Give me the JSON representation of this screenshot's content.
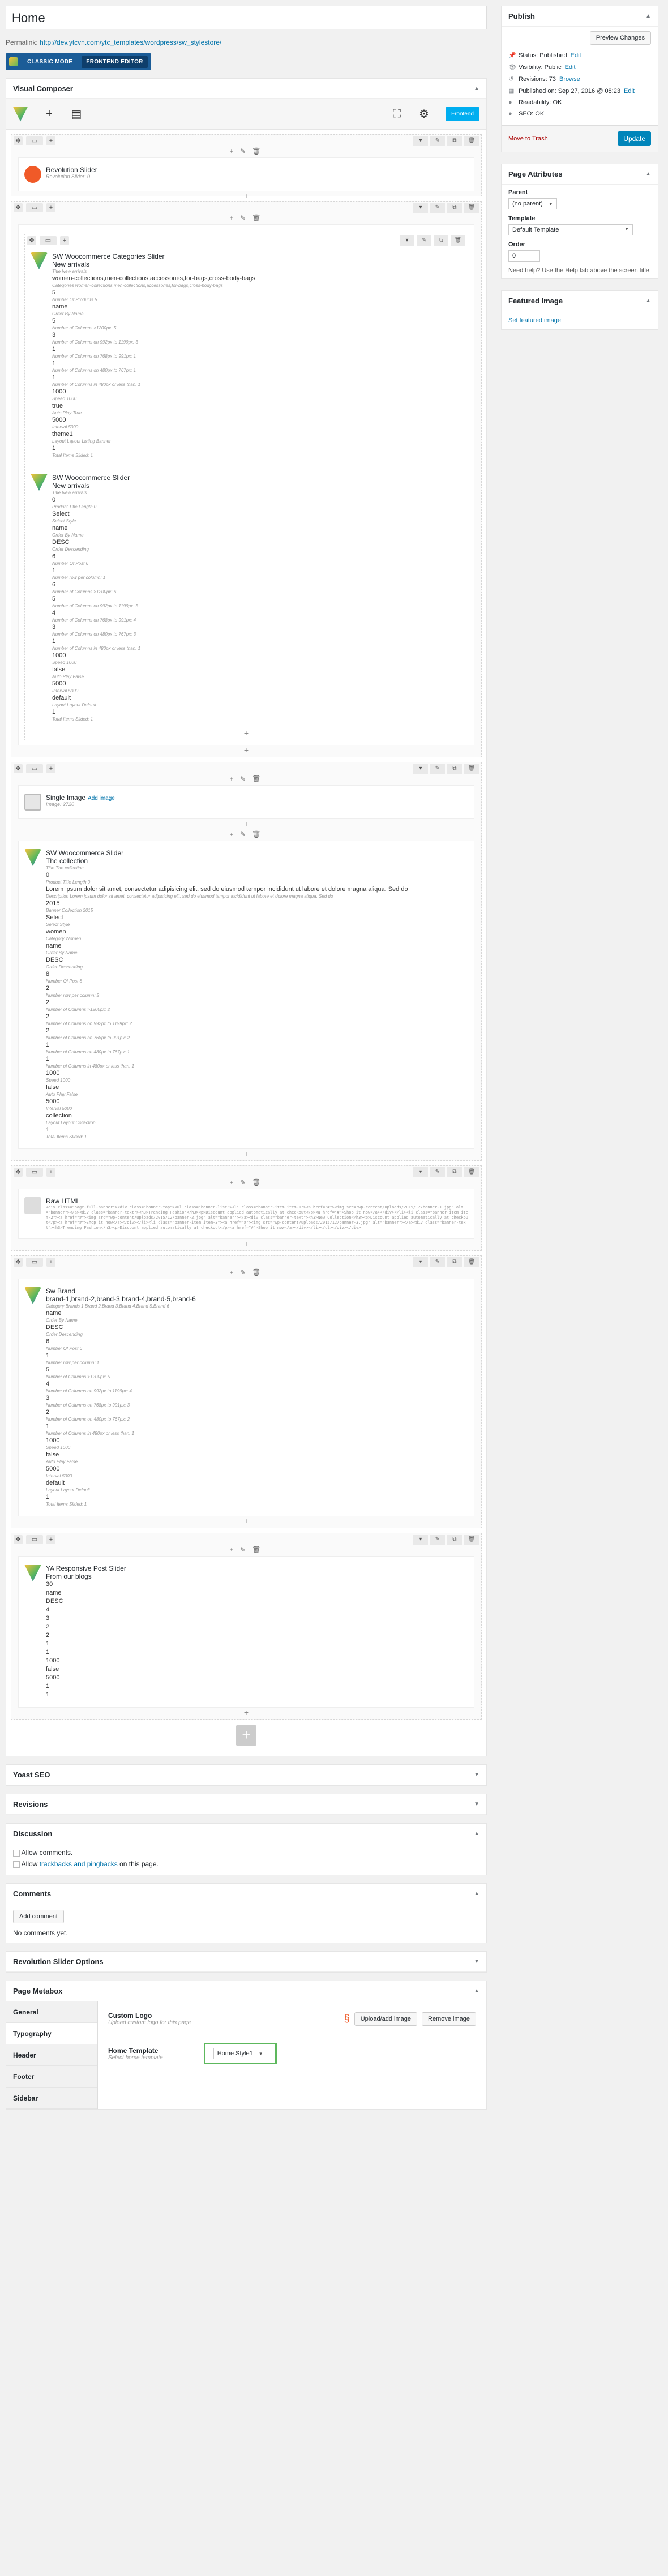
{
  "title": "Home",
  "permalink": {
    "label": "Permalink:",
    "url": "http://dev.ytcvn.com/ytc_templates/wordpress/sw_stylestore/"
  },
  "vc_mode": {
    "classic": "CLASSIC MODE",
    "frontend": "FRONTEND EDITOR"
  },
  "vc": {
    "title": "Visual Composer",
    "frontend_btn": "Frontend"
  },
  "elements": {
    "revolution": {
      "name": "Revolution Slider",
      "desc": "Revolution Slider: 0"
    },
    "cat1": {
      "name": "SW Woocommerce Categories Slider",
      "sub": "New arrivals",
      "params": [
        [
          "",
          "Title New arrivals"
        ],
        [
          "women-collections,men-collections,accessories,for-bags,cross-body-bags",
          "Categories women-collections,men-collections,accessories,for-bags,cross-body-bags"
        ],
        [
          "5",
          "Number Of Products 5"
        ],
        [
          "name",
          "Order By Name"
        ],
        [
          "5",
          "Number of Columns >1200px: 5"
        ],
        [
          "3",
          "Number of Columns on 992px to 1199px: 3"
        ],
        [
          "1",
          "Number of Columns on 768px to 991px: 1"
        ],
        [
          "1",
          "Number of Columns on 480px to 767px: 1"
        ],
        [
          "1",
          "Number of Columns in 480px or less than: 1"
        ],
        [
          "1000",
          "Speed 1000"
        ],
        [
          "true",
          "Auto Play True"
        ],
        [
          "5000",
          "Interval 5000"
        ],
        [
          "theme1",
          "Layout Layout Listing Banner"
        ],
        [
          "1",
          "Total Items Slided: 1"
        ]
      ]
    },
    "cat2": {
      "name": "SW Woocommerce Slider",
      "sub": "New arrivals",
      "params": [
        [
          "",
          "Title New arrivals"
        ],
        [
          "0",
          "Product Title Length 0"
        ],
        [
          "Select",
          "Select Style"
        ],
        [
          "name",
          "Order By Name"
        ],
        [
          "DESC",
          "Order Descending"
        ],
        [
          "6",
          "Number Of Post 6"
        ],
        [
          "1",
          "Number row per column: 1"
        ],
        [
          "6",
          "Number of Columns >1200px: 6"
        ],
        [
          "5",
          "Number of Columns on 992px to 1199px: 5"
        ],
        [
          "4",
          "Number of Columns on 768px to 991px: 4"
        ],
        [
          "3",
          "Number of Columns on 480px to 767px: 3"
        ],
        [
          "1",
          "Number of Columns in 480px or less than: 1"
        ],
        [
          "1000",
          "Speed 1000"
        ],
        [
          "false",
          "Auto Play False"
        ],
        [
          "5000",
          "Interval 5000"
        ],
        [
          "default",
          "Layout Layout Default"
        ],
        [
          "1",
          "Total Items Slided: 1"
        ]
      ]
    },
    "single_image": {
      "name": "Single Image",
      "link": "Add image",
      "desc": "Image: 2720"
    },
    "sw_slider": {
      "name": "SW Woocommerce Slider",
      "sub": "The collection",
      "params": [
        [
          "",
          "Title The collection"
        ],
        [
          "0",
          "Product Title Length 0"
        ],
        [
          "Lorem ipsum dolor sit amet, consectetur adipisicing elit, sed do eiusmod tempor incididunt ut labore et dolore magna aliqua. Sed do",
          "Description Lorem ipsum dolor sit amet, consectetur adipisicing elit, sed do eiusmod tempor incididunt ut labore et dolore magna aliqua. Sed do"
        ],
        [
          "2015",
          "Banner Collection 2015"
        ],
        [
          "Select",
          "Select Style"
        ],
        [
          "women",
          "Category Women"
        ],
        [
          "name",
          "Order By Name"
        ],
        [
          "DESC",
          "Order Descending"
        ],
        [
          "8",
          "Number Of Post 8"
        ],
        [
          "2",
          "Number row per column: 2"
        ],
        [
          "2",
          "Number of Columns >1200px: 2"
        ],
        [
          "2",
          "Number of Columns on 992px to 1199px: 2"
        ],
        [
          "2",
          "Number of Columns on 768px to 991px: 2"
        ],
        [
          "1",
          "Number of Columns on 480px to 767px: 1"
        ],
        [
          "1",
          "Number of Columns in 480px or less than: 1"
        ],
        [
          "1000",
          "Speed 1000"
        ],
        [
          "false",
          "Auto Play False"
        ],
        [
          "5000",
          "Interval 5000"
        ],
        [
          "collection",
          "Layout Layout Collection"
        ],
        [
          "1",
          "Total Items Slided: 1"
        ]
      ]
    },
    "raw_html": {
      "name": "Raw HTML",
      "code": "<div class=\"page-full-banner\"><div class=\"banner-top\"><ul class=\"banner-list\"><li class=\"banner-item item-1\"><a href=\"#\"><img src=\"wp-content/uploads/2015/12/banner-1.jpg\" alt=\"banner\"></a><div class=\"banner-text\"><h3>Trending Fashion</h3><p>Discount applied automatically at checkout</p><a href=\"#\">Shop it now</a></div></li><li class=\"banner-item item-2\"><a href=\"#\"><img src=\"wp-content/uploads/2015/12/banner-2.jpg\" alt=\"banner\"></a><div class=\"banner-text\"><h3>New Collection</h3><p>Discount applied automatically at checkout</p><a href=\"#\">Shop it now</a></div></li><li class=\"banner-item item-3\"><a href=\"#\"><img src=\"wp-content/uploads/2015/12/banner-3.jpg\" alt=\"banner\"></a><div class=\"banner-text\"><h3>Trending Fashion</h3><p>Discount applied automatically at checkout</p><a href=\"#\">Shop it now</a></div></li></ul></div></div>"
    },
    "brand": {
      "name": "Sw Brand",
      "sub": "brand-1,brand-2,brand-3,brand-4,brand-5,brand-6",
      "params": [
        [
          "",
          "Category Brands 1,Brand 2,Brand 3,Brand 4,Brand 5,Brand 6"
        ],
        [
          "name",
          "Order By Name"
        ],
        [
          "DESC",
          "Order Descending"
        ],
        [
          "6",
          "Number Of Post 6"
        ],
        [
          "1",
          "Number row per column: 1"
        ],
        [
          "5",
          "Number of Columns >1200px: 5"
        ],
        [
          "4",
          "Number of Columns on 992px to 1199px: 4"
        ],
        [
          "3",
          "Number of Columns on 768px to 991px: 3"
        ],
        [
          "2",
          "Number of Columns on 480px to 767px: 2"
        ],
        [
          "1",
          "Number of Columns in 480px or less than: 1"
        ],
        [
          "1000",
          "Speed 1000"
        ],
        [
          "false",
          "Auto Play False"
        ],
        [
          "5000",
          "Interval 5000"
        ],
        [
          "default",
          "Layout Layout Default"
        ],
        [
          "1",
          "Total Items Slided: 1"
        ]
      ]
    },
    "ya": {
      "name": "YA Responsive Post Slider",
      "sub": "From our blogs",
      "values": [
        "30",
        "name",
        "DESC",
        "4",
        "3",
        "2",
        "2",
        "1",
        "1",
        "1000",
        "false",
        "5000",
        "1",
        "1"
      ]
    }
  },
  "boxes": {
    "seo": "Yoast SEO",
    "revisions": "Revisions",
    "discussion": "Discussion",
    "allow_comments": "Allow comments.",
    "allow_trackbacks_pre": "Allow",
    "allow_trackbacks_link": "trackbacks and pingbacks",
    "allow_trackbacks_post": "on this page.",
    "comments": "Comments",
    "add_comment": "Add comment",
    "no_comments": "No comments yet.",
    "rev_slider": "Revolution Slider Options",
    "page_metabox": "Page Metabox"
  },
  "metabox": {
    "tabs": [
      "General",
      "Typography",
      "Header",
      "Footer",
      "Sidebar"
    ],
    "custom_logo": "Custom Logo",
    "custom_logo_desc": "Upload custom logo for this page",
    "upload_btn": "Upload/add image",
    "remove_btn": "Remove image",
    "home_template": "Home Template",
    "home_template_desc": "Select home template",
    "home_template_value": "Home Style1"
  },
  "publish": {
    "title": "Publish",
    "preview": "Preview Changes",
    "status": "Status: Published",
    "visibility": "Visibility: Public",
    "revisions": "Revisions: 73",
    "browse": "Browse",
    "published": "Published on: Sep 27, 2016 @ 08:23",
    "readability": "Readability: OK",
    "seo": "SEO: OK",
    "edit": "Edit",
    "trash": "Move to Trash",
    "update": "Update"
  },
  "page_attr": {
    "title": "Page Attributes",
    "parent_label": "Parent",
    "parent_value": "(no parent)",
    "template_label": "Template",
    "template_value": "Default Template",
    "order_label": "Order",
    "order_value": "0",
    "help": "Need help? Use the Help tab above the screen title."
  },
  "featured": {
    "title": "Featured Image",
    "link": "Set featured image"
  },
  "colors": {
    "accent": "#0073aa",
    "vc_frontend": "#00aef0",
    "update": "#0085ba",
    "highlight": "#5db85d"
  }
}
